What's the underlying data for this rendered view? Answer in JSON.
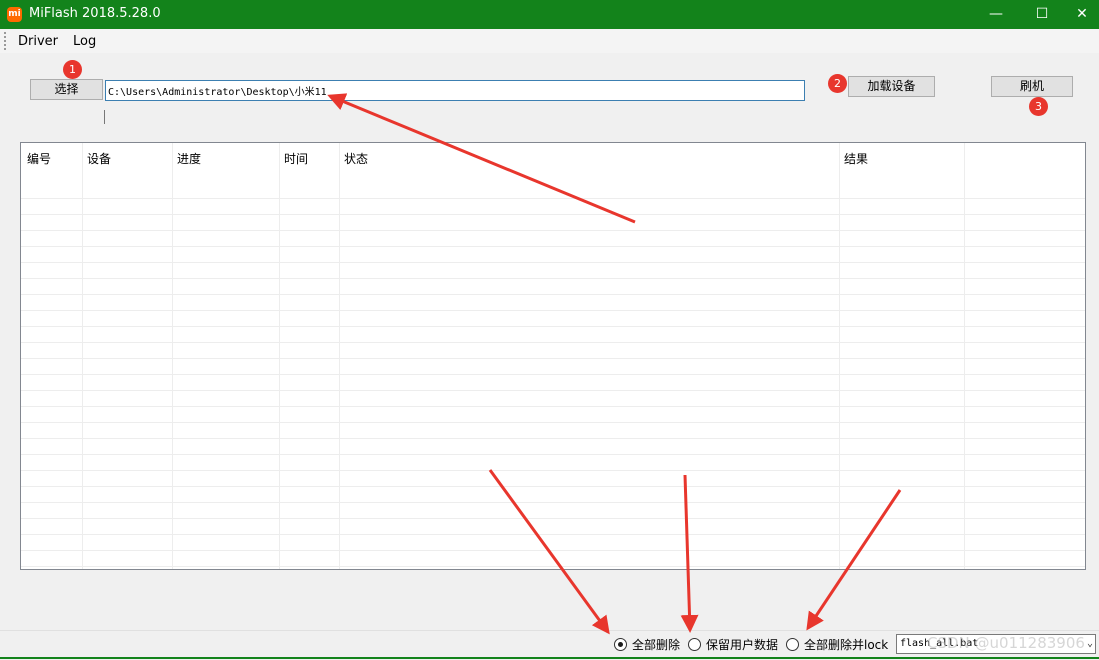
{
  "window": {
    "app_icon_text": "mi",
    "title": "MiFlash 2018.5.28.0",
    "controls": [
      "—",
      "☐",
      "✕"
    ]
  },
  "menu": {
    "items": [
      "Driver",
      "Log"
    ]
  },
  "toolbar": {
    "select_label": "选择",
    "path_value": "C:\\Users\\Administrator\\Desktop\\小米11",
    "load_device_label": "加载设备",
    "flash_label": "刷机"
  },
  "annotations": {
    "badges": [
      "1",
      "2",
      "3"
    ],
    "color": "#e8362d"
  },
  "table": {
    "columns": [
      "编号",
      "设备",
      "进度",
      "时间",
      "状态",
      "结果",
      ""
    ],
    "rows": []
  },
  "bottom": {
    "options": [
      {
        "label": "全部删除",
        "selected": true
      },
      {
        "label": "保留用户数据",
        "selected": false
      },
      {
        "label": "全部删除并lock",
        "selected": false
      }
    ],
    "script_select": "flash_all.bat",
    "watermark": "CSDN @u011283906"
  },
  "colors": {
    "titlebar": "#13831b",
    "input_border": "#3c7fb1",
    "arrow": "#e8362d"
  }
}
